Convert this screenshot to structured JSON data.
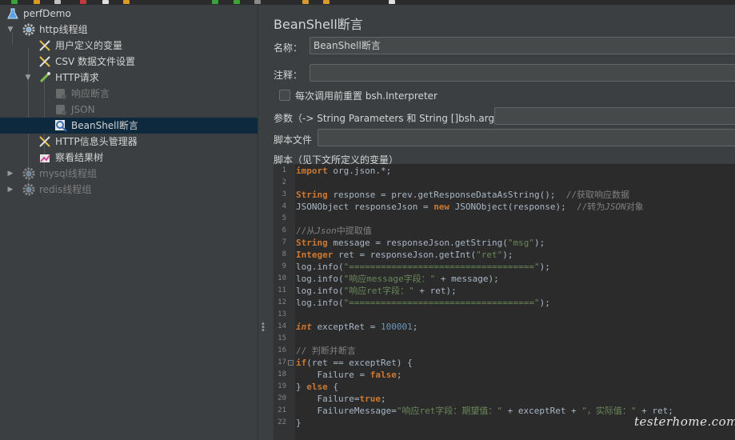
{
  "tree": {
    "items": [
      {
        "label": "perfDemo",
        "icon": "flask-icon",
        "caret": "",
        "dim": false,
        "selected": false
      },
      {
        "label": "http线程组",
        "icon": "gear-icon",
        "caret": "▼",
        "dim": false,
        "selected": false
      },
      {
        "label": "用户定义的变量",
        "icon": "tools-icon",
        "caret": "",
        "dim": false,
        "selected": false
      },
      {
        "label": "CSV 数据文件设置",
        "icon": "tools-icon",
        "caret": "",
        "dim": false,
        "selected": false
      },
      {
        "label": "HTTP请求",
        "icon": "pipette-icon",
        "caret": "▼",
        "dim": false,
        "selected": false
      },
      {
        "label": "响应断言",
        "icon": "assertion-icon",
        "caret": "",
        "dim": true,
        "selected": false
      },
      {
        "label": "JSON",
        "icon": "assertion-icon",
        "caret": "",
        "dim": true,
        "selected": false
      },
      {
        "label": "BeanShell断言",
        "icon": "magnifier-icon",
        "caret": "",
        "dim": false,
        "selected": true
      },
      {
        "label": "HTTP信息头管理器",
        "icon": "tools-icon",
        "caret": "",
        "dim": false,
        "selected": false
      },
      {
        "label": "察看结果树",
        "icon": "chart-icon",
        "caret": "",
        "dim": false,
        "selected": false
      },
      {
        "label": "mysql线程组",
        "icon": "gear-icon",
        "caret": "▶",
        "dim": true,
        "selected": false
      },
      {
        "label": "redis线程组",
        "icon": "gear-icon",
        "caret": "▶",
        "dim": true,
        "selected": false
      }
    ]
  },
  "form": {
    "title": "BeanShell断言",
    "name_label": "名称：",
    "name_value": "BeanShell断言",
    "comment_label": "注释：",
    "comment_value": "",
    "reset_label": "每次调用前重置 bsh.Interpreter",
    "params_label": "参数（-> String Parameters 和 String []bsh.args）",
    "params_value": "",
    "script_file_label": "脚本文件",
    "script_file_value": "",
    "script_label": "脚本（见下文所定义的变量）"
  },
  "code_lines": [
    {
      "n": "1",
      "fold": "",
      "tokens": [
        {
          "t": "import",
          "c": "kw"
        },
        {
          "t": " org.json.*;",
          "c": ""
        }
      ]
    },
    {
      "n": "2",
      "fold": "",
      "tokens": []
    },
    {
      "n": "3",
      "fold": "",
      "tokens": [
        {
          "t": "String",
          "c": "kw"
        },
        {
          "t": " response = prev.getResponseDataAsString();  ",
          "c": ""
        },
        {
          "t": "//获取响应数据",
          "c": "cmt"
        }
      ]
    },
    {
      "n": "4",
      "fold": "",
      "tokens": [
        {
          "t": "JSONObject responseJson = ",
          "c": ""
        },
        {
          "t": "new",
          "c": "kw"
        },
        {
          "t": " JSONObject(response);  ",
          "c": ""
        },
        {
          "t": "//转为",
          "c": "cmt"
        },
        {
          "t": "JSON",
          "c": "cmti"
        },
        {
          "t": "对象",
          "c": "cmt"
        }
      ]
    },
    {
      "n": "5",
      "fold": "",
      "tokens": []
    },
    {
      "n": "6",
      "fold": "",
      "tokens": [
        {
          "t": "//从",
          "c": "cmt"
        },
        {
          "t": "Json",
          "c": "cmti"
        },
        {
          "t": "中提取值",
          "c": "cmt"
        }
      ]
    },
    {
      "n": "7",
      "fold": "",
      "tokens": [
        {
          "t": "String",
          "c": "kw"
        },
        {
          "t": " message = responseJson.getString(",
          "c": ""
        },
        {
          "t": "\"msg\"",
          "c": "str"
        },
        {
          "t": ");",
          "c": ""
        }
      ]
    },
    {
      "n": "8",
      "fold": "",
      "tokens": [
        {
          "t": "Integer",
          "c": "kw"
        },
        {
          "t": " ret = responseJson.getInt(",
          "c": ""
        },
        {
          "t": "\"ret\"",
          "c": "str"
        },
        {
          "t": ");",
          "c": ""
        }
      ]
    },
    {
      "n": "9",
      "fold": "",
      "tokens": [
        {
          "t": "log.info(",
          "c": ""
        },
        {
          "t": "\"===================================\"",
          "c": "str"
        },
        {
          "t": ");",
          "c": ""
        }
      ]
    },
    {
      "n": "10",
      "fold": "",
      "tokens": [
        {
          "t": "log.info(",
          "c": ""
        },
        {
          "t": "\"响应message字段：\"",
          "c": "str"
        },
        {
          "t": " + message);",
          "c": ""
        }
      ]
    },
    {
      "n": "11",
      "fold": "",
      "tokens": [
        {
          "t": "log.info(",
          "c": ""
        },
        {
          "t": "\"响应ret字段：\"",
          "c": "str"
        },
        {
          "t": " + ret);",
          "c": ""
        }
      ]
    },
    {
      "n": "12",
      "fold": "",
      "tokens": [
        {
          "t": "log.info(",
          "c": ""
        },
        {
          "t": "\"===================================\"",
          "c": "str"
        },
        {
          "t": ");",
          "c": ""
        }
      ]
    },
    {
      "n": "13",
      "fold": "",
      "tokens": []
    },
    {
      "n": "14",
      "fold": "",
      "tokens": [
        {
          "t": "int",
          "c": "kwi"
        },
        {
          "t": " exceptRet = ",
          "c": ""
        },
        {
          "t": "100001",
          "c": "num"
        },
        {
          "t": ";",
          "c": ""
        }
      ]
    },
    {
      "n": "15",
      "fold": "",
      "tokens": []
    },
    {
      "n": "16",
      "fold": "",
      "tokens": [
        {
          "t": "// 判断并断言",
          "c": "cmt"
        }
      ]
    },
    {
      "n": "17",
      "fold": "-",
      "tokens": [
        {
          "t": "if",
          "c": "kw"
        },
        {
          "t": "(ret == exceptRet) {",
          "c": ""
        }
      ]
    },
    {
      "n": "18",
      "fold": "",
      "tokens": [
        {
          "t": "    Failure = ",
          "c": ""
        },
        {
          "t": "false",
          "c": "kw"
        },
        {
          "t": ";",
          "c": ""
        }
      ]
    },
    {
      "n": "19",
      "fold": "",
      "tokens": [
        {
          "t": "} ",
          "c": ""
        },
        {
          "t": "else",
          "c": "kw"
        },
        {
          "t": " {",
          "c": ""
        }
      ]
    },
    {
      "n": "20",
      "fold": "",
      "tokens": [
        {
          "t": "    Failure=",
          "c": ""
        },
        {
          "t": "true",
          "c": "kw"
        },
        {
          "t": ";",
          "c": ""
        }
      ]
    },
    {
      "n": "21",
      "fold": "",
      "tokens": [
        {
          "t": "    FailureMessage=",
          "c": ""
        },
        {
          "t": "\"响应ret字段：期望值：\"",
          "c": "str"
        },
        {
          "t": " + exceptRet + ",
          "c": ""
        },
        {
          "t": "\"，实际值：\"",
          "c": "str"
        },
        {
          "t": " + ret;",
          "c": ""
        }
      ]
    },
    {
      "n": "22",
      "fold": "",
      "tokens": [
        {
          "t": "}",
          "c": ""
        }
      ]
    }
  ],
  "watermark": "testerhome.com",
  "colors": {
    "selected": "#0d293e",
    "keyword": "#cc7832",
    "string": "#6a8759",
    "number": "#6897bb",
    "comment": "#808080"
  }
}
